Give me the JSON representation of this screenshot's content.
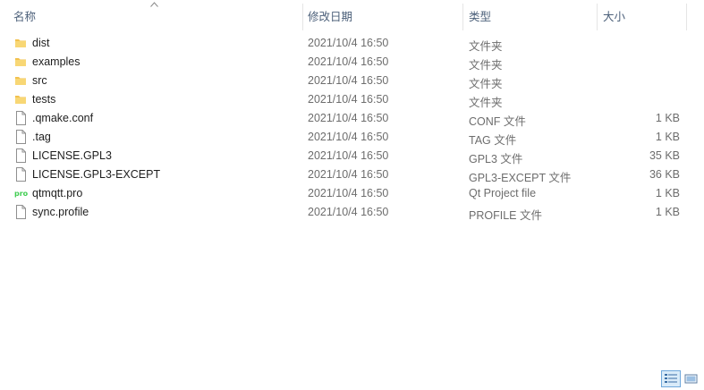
{
  "columns": {
    "name": "名称",
    "date_modified": "修改日期",
    "type": "类型",
    "size": "大小"
  },
  "files": [
    {
      "name": "dist",
      "date": "2021/10/4 16:50",
      "type": "文件夹",
      "size": "",
      "icon": "folder-icon"
    },
    {
      "name": "examples",
      "date": "2021/10/4 16:50",
      "type": "文件夹",
      "size": "",
      "icon": "folder-icon"
    },
    {
      "name": "src",
      "date": "2021/10/4 16:50",
      "type": "文件夹",
      "size": "",
      "icon": "folder-icon"
    },
    {
      "name": "tests",
      "date": "2021/10/4 16:50",
      "type": "文件夹",
      "size": "",
      "icon": "folder-icon"
    },
    {
      "name": ".qmake.conf",
      "date": "2021/10/4 16:50",
      "type": "CONF 文件",
      "size": "1 KB",
      "icon": "file-icon"
    },
    {
      "name": ".tag",
      "date": "2021/10/4 16:50",
      "type": "TAG 文件",
      "size": "1 KB",
      "icon": "file-icon"
    },
    {
      "name": "LICENSE.GPL3",
      "date": "2021/10/4 16:50",
      "type": "GPL3 文件",
      "size": "35 KB",
      "icon": "file-icon"
    },
    {
      "name": "LICENSE.GPL3-EXCEPT",
      "date": "2021/10/4 16:50",
      "type": "GPL3-EXCEPT 文件",
      "size": "36 KB",
      "icon": "file-icon"
    },
    {
      "name": "qtmqtt.pro",
      "date": "2021/10/4 16:50",
      "type": "Qt Project file",
      "size": "1 KB",
      "icon": "qt-project-file-icon"
    },
    {
      "name": "sync.profile",
      "date": "2021/10/4 16:50",
      "type": "PROFILE 文件",
      "size": "1 KB",
      "icon": "file-icon"
    }
  ],
  "view_modes": {
    "active": "details",
    "icons": [
      "details-view-icon",
      "tiles-view-icon"
    ]
  },
  "colors": {
    "header_text": "#4c607a",
    "folder": "#f2c14e",
    "qt_green": "#41cd52",
    "active_view_bg": "#d9ebf9"
  }
}
